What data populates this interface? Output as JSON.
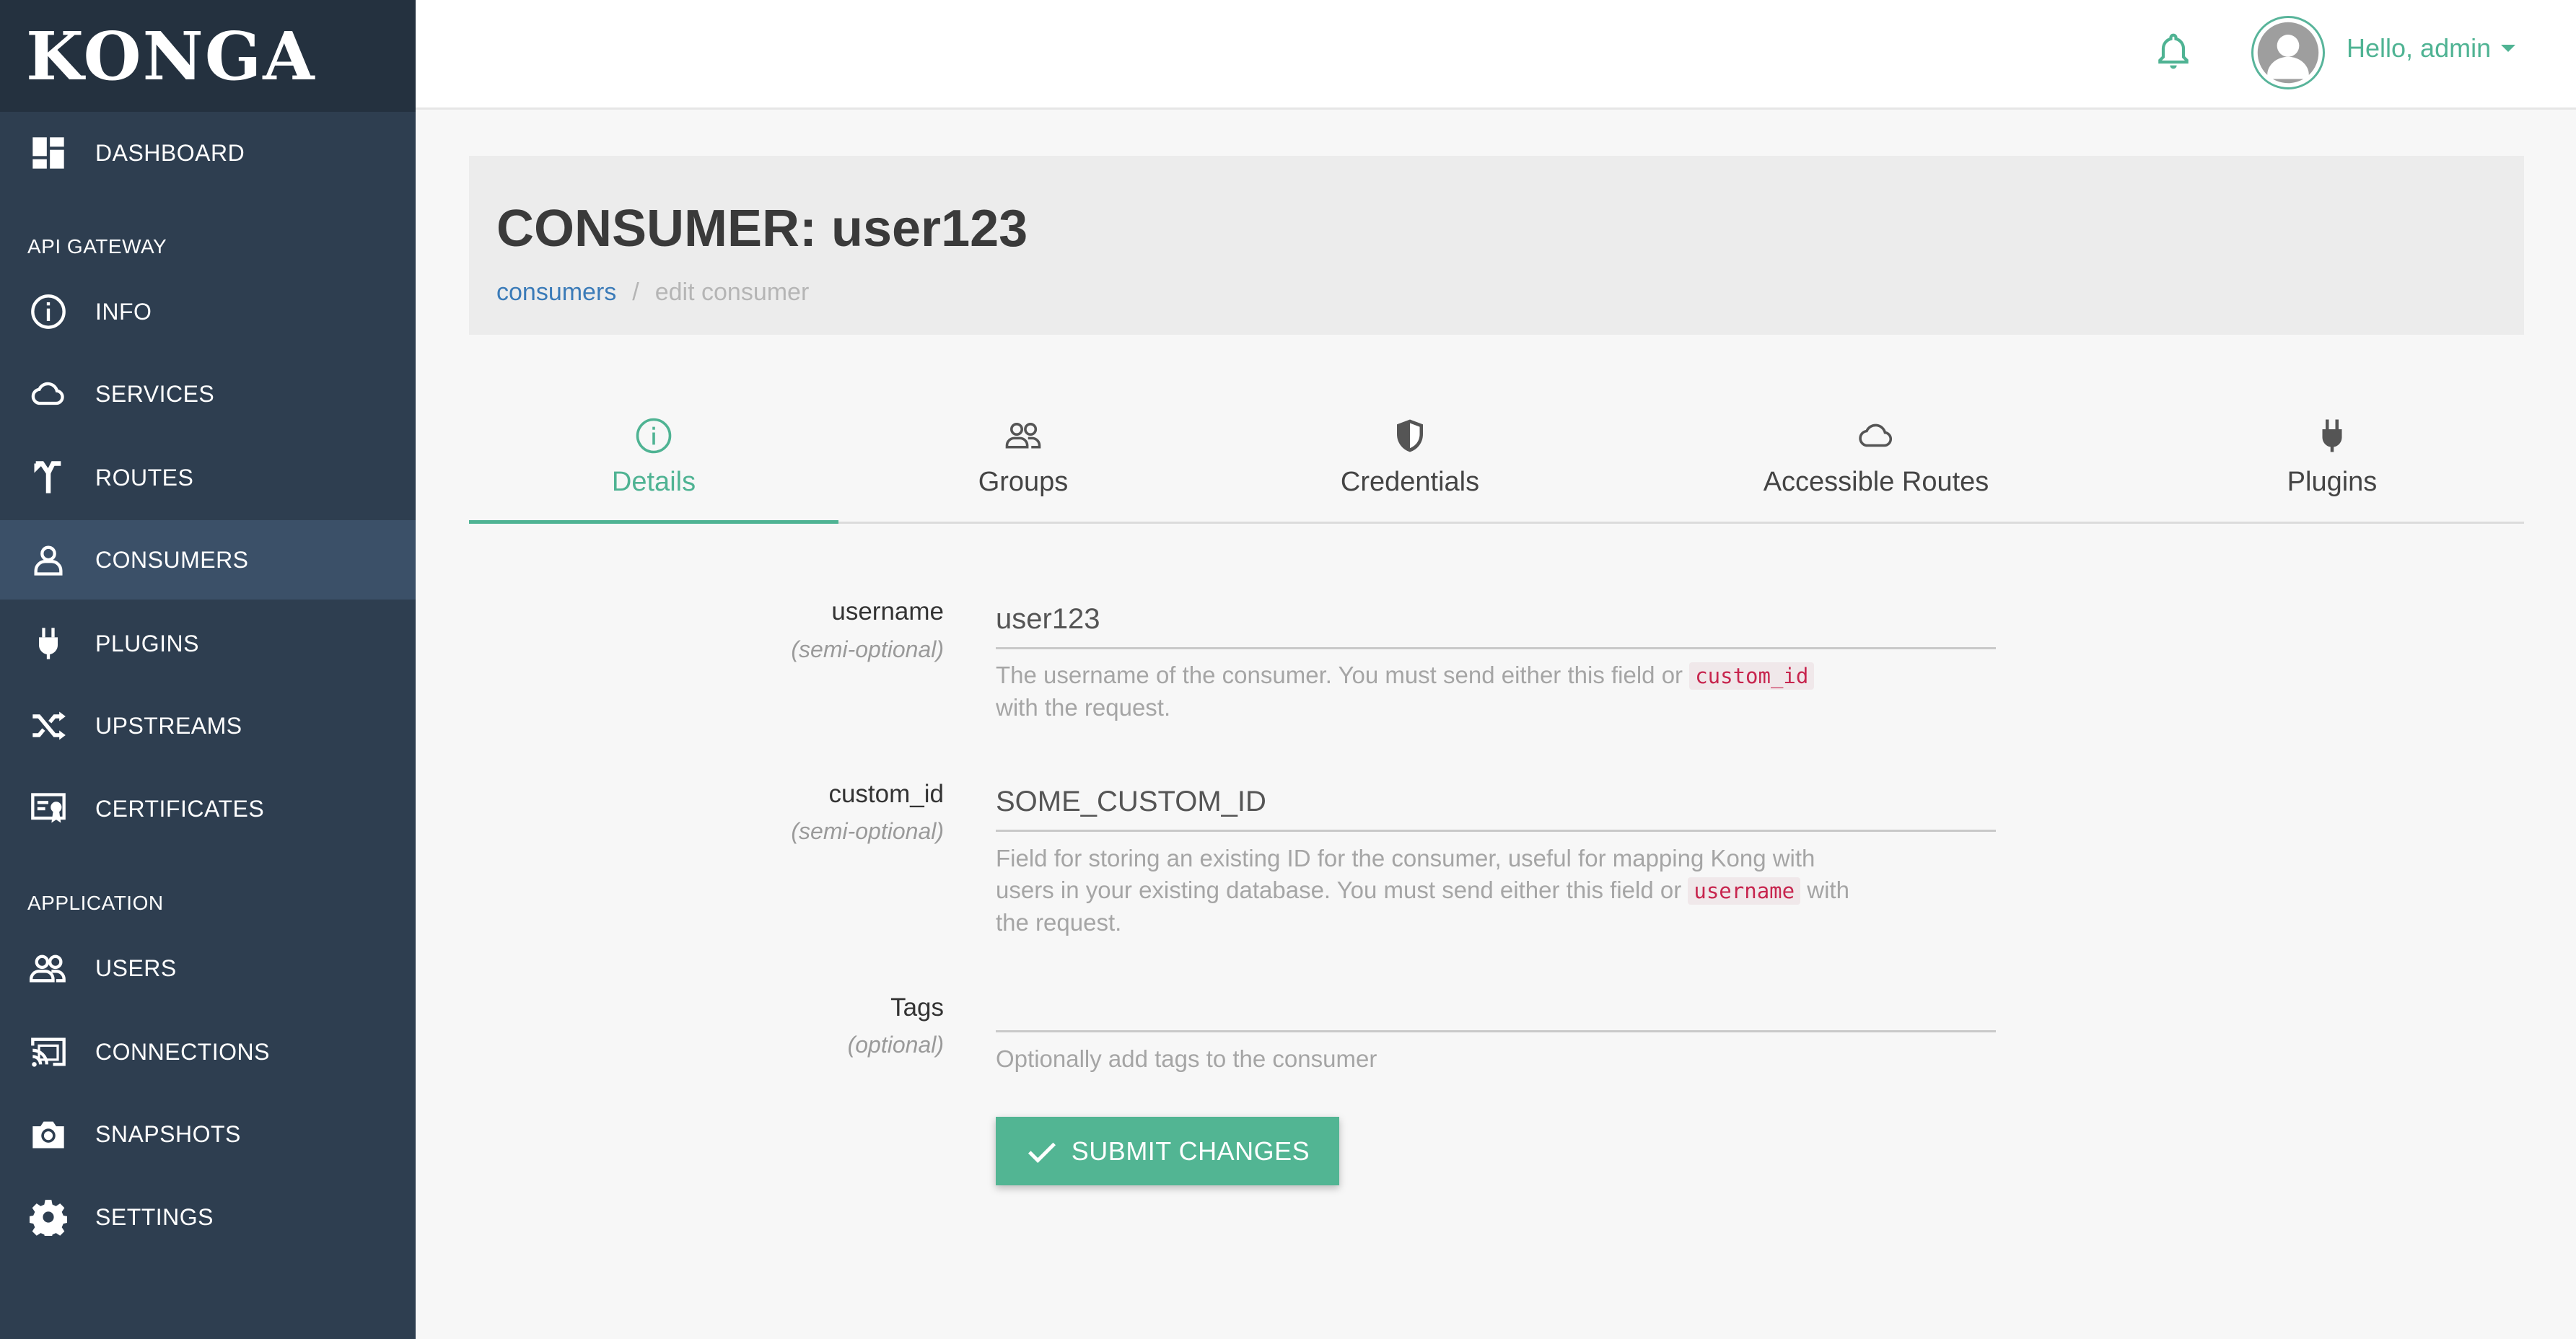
{
  "app": {
    "brand": "KONGA"
  },
  "sidebar": {
    "dashboard": "DASHBOARD",
    "section_api_gateway": "API GATEWAY",
    "info": "INFO",
    "services": "SERVICES",
    "routes": "ROUTES",
    "consumers": "CONSUMERS",
    "plugins": "PLUGINS",
    "upstreams": "UPSTREAMS",
    "certificates": "CERTIFICATES",
    "section_application": "APPLICATION",
    "users": "USERS",
    "connections": "CONNECTIONS",
    "snapshots": "SNAPSHOTS",
    "settings": "SETTINGS",
    "active_item": "consumers"
  },
  "topbar": {
    "greeting": "Hello, admin"
  },
  "header": {
    "title": "CONSUMER: user123",
    "breadcrumb_link": "consumers",
    "breadcrumb_separator": "/",
    "breadcrumb_current": "edit consumer"
  },
  "tabs": {
    "details": "Details",
    "groups": "Groups",
    "credentials": "Credentials",
    "accessible_routes": "Accessible Routes",
    "plugins": "Plugins",
    "active": "details"
  },
  "form": {
    "username": {
      "label": "username",
      "qualifier": "(semi-optional)",
      "value": "user123",
      "help_before": "The username of the consumer. You must send either this field or",
      "help_code": "custom_id",
      "help_after": "with the request."
    },
    "custom_id": {
      "label": "custom_id",
      "qualifier": "(semi-optional)",
      "value": "SOME_CUSTOM_ID",
      "help_line1": "Field for storing an existing ID for the consumer, useful for mapping Kong with",
      "help_line2_before": "users in your existing database. You must send either this field or",
      "help_code": "username",
      "help_line2_after": "with",
      "help_line3": "the request."
    },
    "tags": {
      "label": "Tags",
      "qualifier": "(optional)",
      "value": "",
      "help": "Optionally add tags to the consumer"
    },
    "submit_label": "SUBMIT CHANGES"
  },
  "colors": {
    "sidebar_bg": "#2e3e50",
    "sidebar_active": "#3b5068",
    "accent": "#4fb393",
    "link": "#3b7bb8",
    "code": "#c7254e"
  }
}
